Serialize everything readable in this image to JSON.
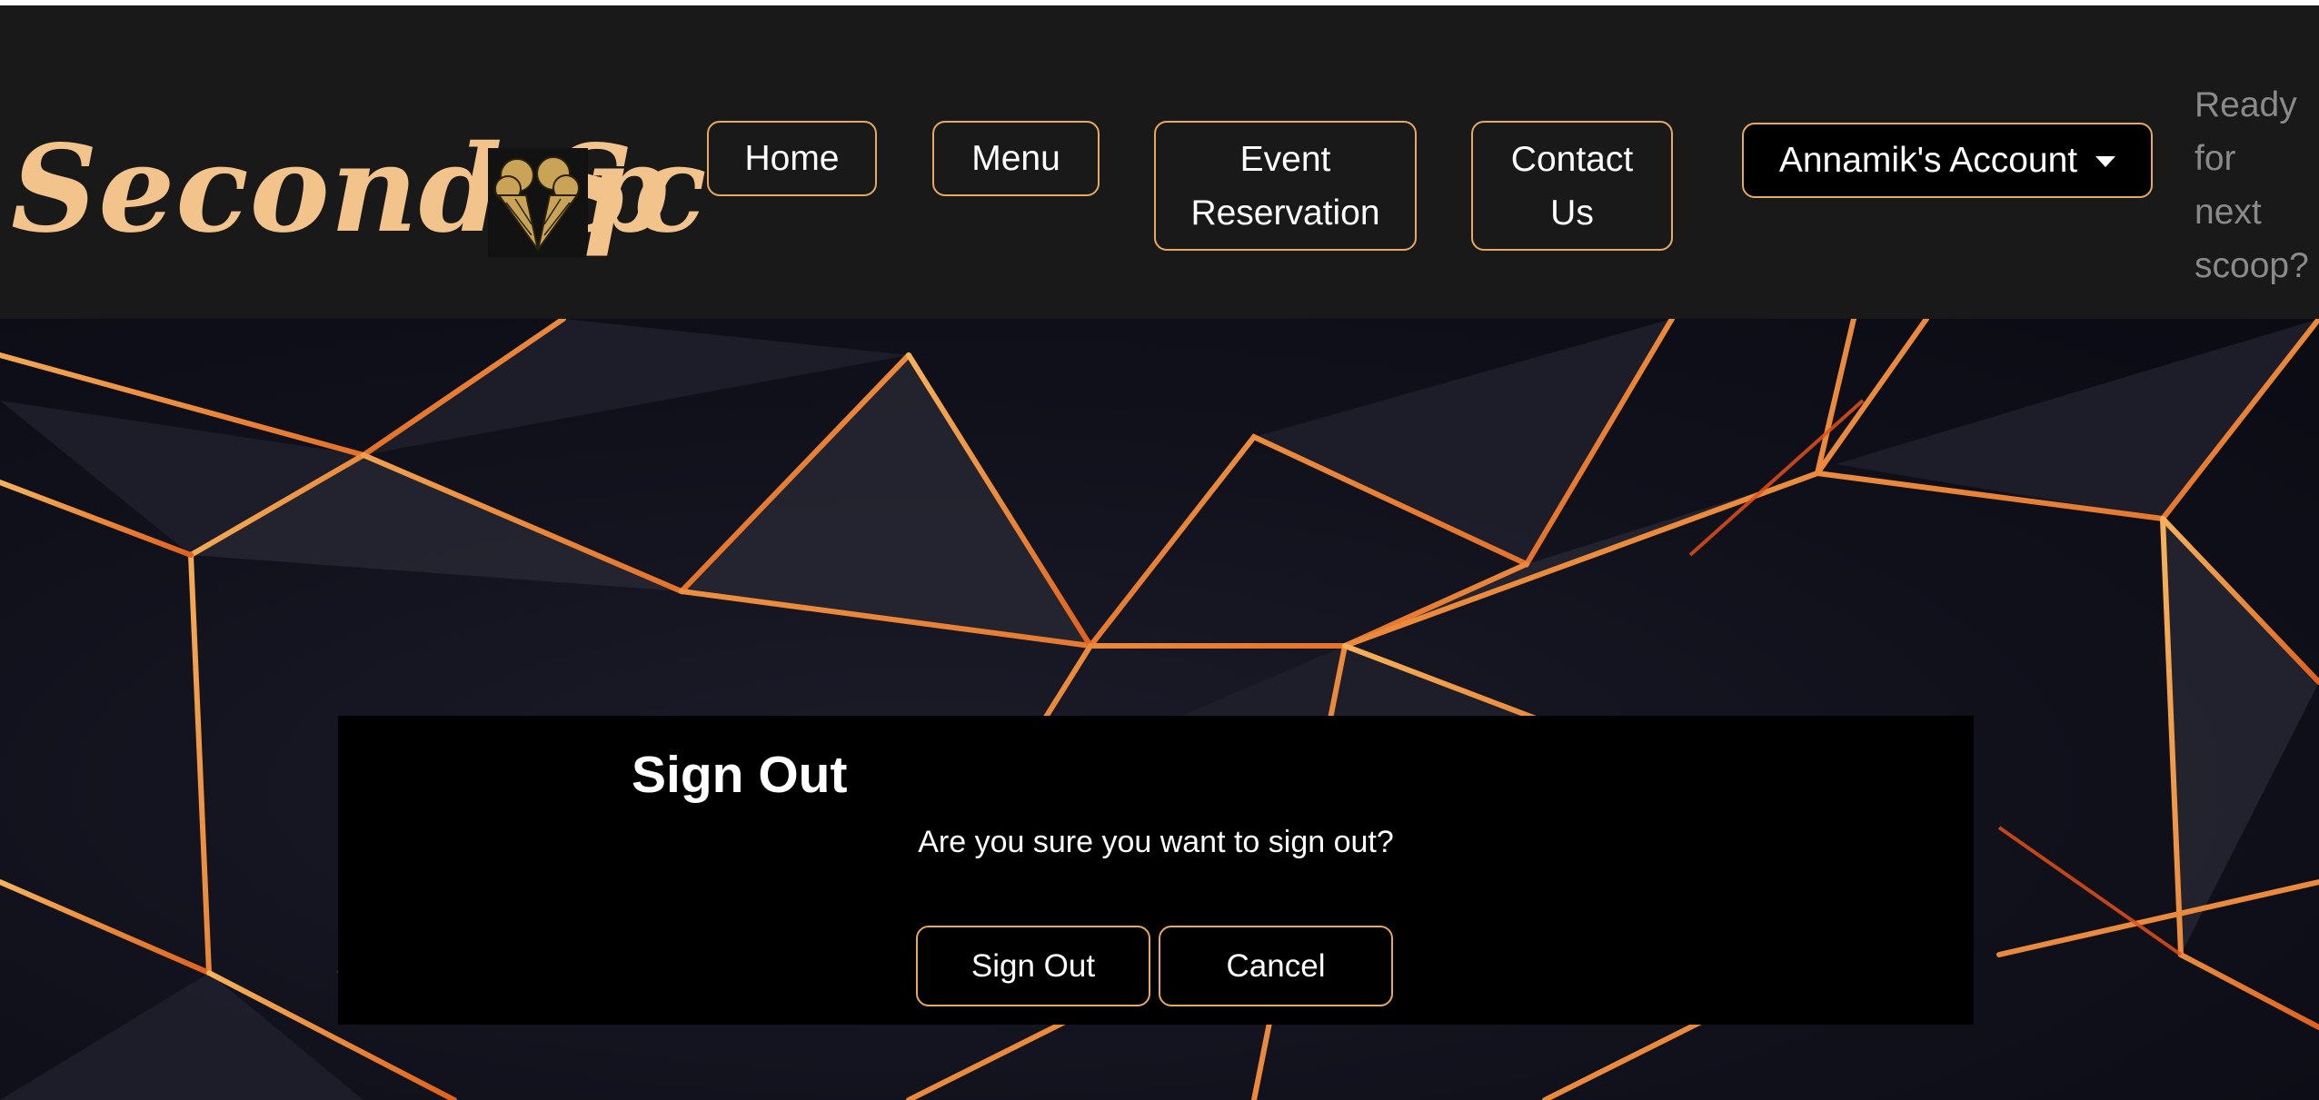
{
  "brand": {
    "logo_text": "Second Sc",
    "logo_tail": "p",
    "logo_icon": "ice-cream-cones-icon"
  },
  "nav": {
    "home": "Home",
    "menu": "Menu",
    "event_line1": "Event",
    "event_line2": "Reservation",
    "contact_line1": "Contact",
    "contact_line2": "Us",
    "account": "Annamik's Account",
    "tagline_1": "Ready",
    "tagline_2": "for",
    "tagline_3": "next",
    "tagline_4": "scoop?"
  },
  "modal": {
    "title": "Sign Out",
    "message": "Are you sure you want to sign out?",
    "confirm_label": "Sign Out",
    "cancel_label": "Cancel"
  },
  "colors": {
    "accent": "#e7a95d",
    "logo": "#f2c48b",
    "navbar_bg": "#191919",
    "modal_bg": "#000000"
  }
}
